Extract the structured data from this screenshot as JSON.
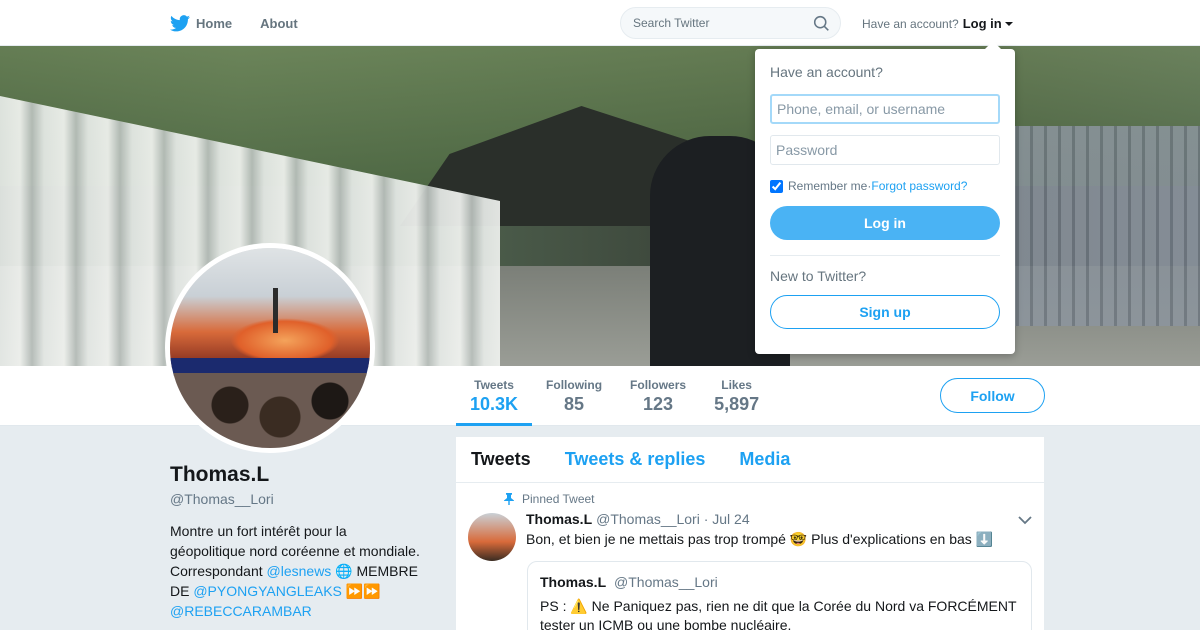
{
  "nav": {
    "home_label": "Home",
    "about_label": "About",
    "search_placeholder": "Search Twitter",
    "have_account": "Have an account?",
    "login_label": "Log in"
  },
  "stats": [
    {
      "label": "Tweets",
      "value": "10.3K"
    },
    {
      "label": "Following",
      "value": "85"
    },
    {
      "label": "Followers",
      "value": "123"
    },
    {
      "label": "Likes",
      "value": "5,897"
    }
  ],
  "follow_label": "Follow",
  "profile": {
    "name": "Thomas.L",
    "handle": "@Thomas__Lori",
    "bio_line1": "Montre un fort intérêt pour la",
    "bio_line2": "géopolitique nord coréenne et mondiale.",
    "bio_line3_prefix": "Correspondant ",
    "bio_link1": "@lesnews",
    "bio_line3_suffix": " 🌐 MEMBRE",
    "bio_line4_prefix": "DE ",
    "bio_link2": "@PYONGYANGLEAKS",
    "bio_line4_suffix": " ⏩⏩",
    "bio_link3": "@REBECCARAMBAR"
  },
  "timeline": {
    "tabs": [
      "Tweets",
      "Tweets & replies",
      "Media"
    ],
    "pinned_label": "Pinned Tweet",
    "tweet": {
      "name": "Thomas.L",
      "handle_date": "@Thomas__Lori · Jul 24",
      "text": "Bon, et bien je ne mettais pas trop trompé 🤓 Plus d'explications en bas ⬇️",
      "quote": {
        "name": "Thomas.L",
        "handle": "@Thomas__Lori",
        "text": "PS : ⚠️ Ne Paniquez pas, rien ne dit que la Corée du Nord va FORCÉMENT tester un ICMB ou une bombe nucléaire."
      }
    }
  },
  "login_dropdown": {
    "title": "Have an account?",
    "username_placeholder": "Phone, email, or username",
    "password_placeholder": "Password",
    "remember_label": "Remember me",
    "separator": " · ",
    "forgot_label": "Forgot password?",
    "login_button": "Log in",
    "new_label": "New to Twitter?",
    "signup_button": "Sign up"
  },
  "colors": {
    "accent": "#1da1f2",
    "login_button_bg": "#4ab3f4",
    "background": "#e6ecf0"
  }
}
